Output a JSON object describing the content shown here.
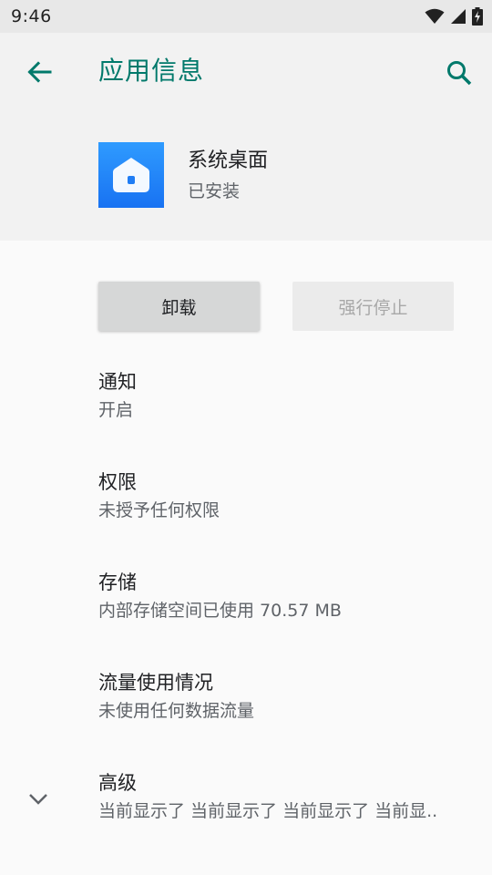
{
  "status_bar": {
    "time": "9:46",
    "icons": [
      "wifi-icon",
      "signal-icon",
      "battery-charging-icon"
    ]
  },
  "toolbar": {
    "title": "应用信息",
    "back_icon": "arrow-back-icon",
    "search_icon": "search-icon",
    "accent_color": "#00796b"
  },
  "app": {
    "name": "系统桌面",
    "status": "已安装",
    "icon": "home-app-icon"
  },
  "actions": {
    "uninstall_label": "卸载",
    "force_stop_label": "强行停止"
  },
  "settings": [
    {
      "title": "通知",
      "summary": "开启"
    },
    {
      "title": "权限",
      "summary": "未授予任何权限"
    },
    {
      "title": "存储",
      "summary": "内部存储空间已使用 70.57 MB"
    },
    {
      "title": "流量使用情况",
      "summary": "未使用任何数据流量"
    },
    {
      "title": "高级",
      "summary": "当前显示了 当前显示了 当前显示了 当前显.."
    }
  ]
}
